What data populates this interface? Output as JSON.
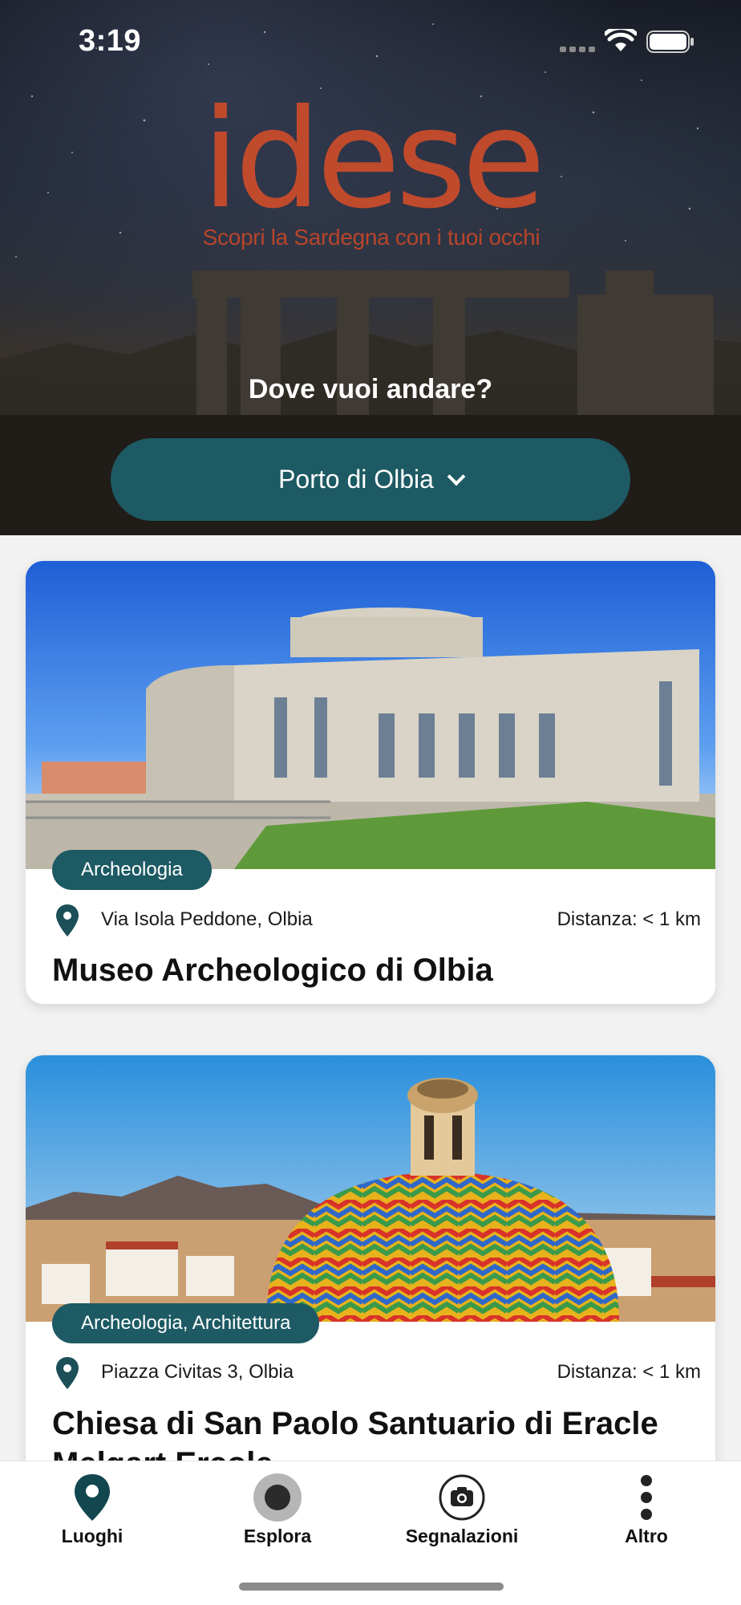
{
  "status_bar": {
    "time": "3:19"
  },
  "logo": {
    "wordmark": "idese",
    "tagline": "Scopri la Sardegna con i tuoi occhi"
  },
  "hero": {
    "question": "Dove vuoi andare?",
    "selected_location": "Porto di Olbia"
  },
  "cards": [
    {
      "badge": "Archeologia",
      "address": "Via Isola Peddone, Olbia",
      "distance": "Distanza: < 1 km",
      "title": "Museo Archeologico di Olbia"
    },
    {
      "badge": "Archeologia, Architettura",
      "address": "Piazza Civitas 3, Olbia",
      "distance": "Distanza: < 1 km",
      "title": "Chiesa di San Paolo Santuario di Eracle Melqart Ercole"
    }
  ],
  "tabbar": {
    "items": [
      {
        "label": "Luoghi",
        "icon": "map-pin-icon"
      },
      {
        "label": "Esplora",
        "icon": "record-icon"
      },
      {
        "label": "Segnalazioni",
        "icon": "camera-icon"
      },
      {
        "label": "Altro",
        "icon": "more-vertical-icon"
      }
    ]
  },
  "colors": {
    "accent": "#1d5a63",
    "brand": "#c04a2c"
  }
}
